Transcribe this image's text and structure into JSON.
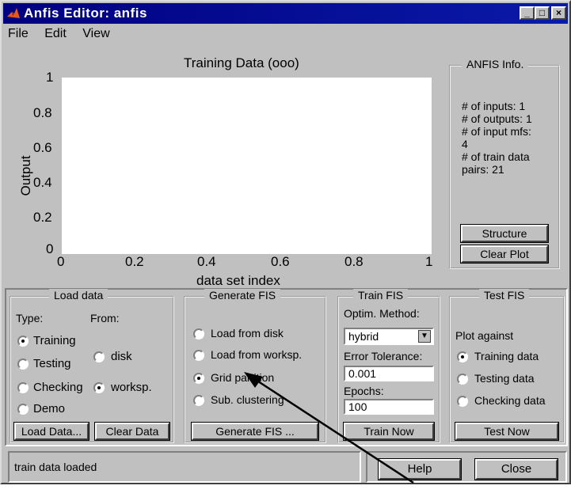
{
  "window": {
    "title": "Anfis Editor: anfis"
  },
  "menu": [
    "File",
    "Edit",
    "View"
  ],
  "plot": {
    "title": "Training Data (ooo)",
    "ylabel": "Output",
    "xlabel": "data set index",
    "yticks": [
      "1",
      "0.8",
      "0.6",
      "0.4",
      "0.2",
      "0"
    ],
    "xticks": [
      "0",
      "0.2",
      "0.4",
      "0.6",
      "0.8",
      "1"
    ]
  },
  "info": {
    "title": "ANFIS Info.",
    "lines": [
      "# of inputs: 1",
      "# of outputs: 1",
      "# of input mfs:",
      "4",
      "# of train data",
      "pairs: 21"
    ],
    "structure_label": "Structure",
    "clear_plot_label": "Clear Plot"
  },
  "load": {
    "title": "Load data",
    "type_label": "Type:",
    "from_label": "From:",
    "types": [
      "Training",
      "Testing",
      "Checking",
      "Demo"
    ],
    "sources": [
      "disk",
      "worksp."
    ],
    "load_button": "Load Data...",
    "clear_button": "Clear Data"
  },
  "generate": {
    "title": "Generate FIS",
    "options": [
      "Load from disk",
      "Load from worksp.",
      "Grid partition",
      "Sub. clustering"
    ],
    "button": "Generate FIS ..."
  },
  "train": {
    "title": "Train FIS",
    "method_label": "Optim. Method:",
    "method_value": "hybrid",
    "tolerance_label": "Error Tolerance:",
    "tolerance_value": "0.001",
    "epochs_label": "Epochs:",
    "epochs_value": "100",
    "button": "Train Now"
  },
  "test": {
    "title": "Test FIS",
    "plot_against": "Plot against",
    "options": [
      "Training data",
      "Testing data",
      "Checking data"
    ],
    "button": "Test Now"
  },
  "status": "train data loaded",
  "help_label": "Help",
  "close_label": "Close"
}
